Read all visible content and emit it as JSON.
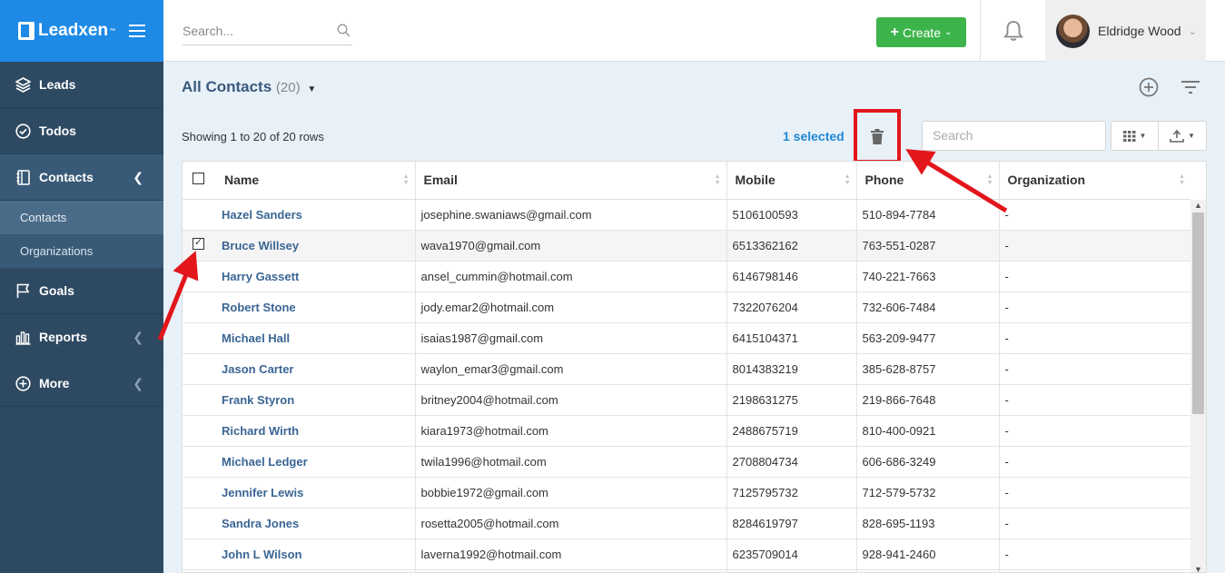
{
  "app": {
    "logo_text": "Leadxen",
    "logo_tm": "™"
  },
  "sidebar": {
    "items": [
      {
        "label": "Leads",
        "icon": "layers-icon"
      },
      {
        "label": "Todos",
        "icon": "check-circle-icon"
      },
      {
        "label": "Contacts",
        "icon": "contacts-book-icon"
      },
      {
        "label": "Goals",
        "icon": "flag-icon"
      },
      {
        "label": "Reports",
        "icon": "bar-chart-icon"
      },
      {
        "label": "More",
        "icon": "plus-circle-icon"
      }
    ],
    "contacts_sub": [
      "Contacts",
      "Organizations"
    ]
  },
  "topbar": {
    "search_placeholder": "Search...",
    "create_label": "Create",
    "user_name": "Eldridge Wood"
  },
  "list": {
    "title": "All Contacts",
    "count": "(20)",
    "showing": "Showing 1 to 20 of 20 rows",
    "selected": "1 selected",
    "search_placeholder": "Search"
  },
  "table": {
    "columns": [
      "Name",
      "Email",
      "Mobile",
      "Phone",
      "Organization"
    ],
    "rows": [
      {
        "name": "Hazel Sanders",
        "email": "josephine.swaniaws@gmail.com",
        "mobile": "5106100593",
        "phone": "510-894-7784",
        "org": "-",
        "checked": false
      },
      {
        "name": "Bruce Willsey",
        "email": "wava1970@gmail.com",
        "mobile": "6513362162",
        "phone": "763-551-0287",
        "org": "-",
        "checked": true
      },
      {
        "name": "Harry Gassett",
        "email": "ansel_cummin@hotmail.com",
        "mobile": "6146798146",
        "phone": "740-221-7663",
        "org": "-",
        "checked": false
      },
      {
        "name": "Robert Stone",
        "email": "jody.emar2@hotmail.com",
        "mobile": "7322076204",
        "phone": "732-606-7484",
        "org": "-",
        "checked": false
      },
      {
        "name": "Michael Hall",
        "email": "isaias1987@gmail.com",
        "mobile": "6415104371",
        "phone": "563-209-9477",
        "org": "-",
        "checked": false
      },
      {
        "name": "Jason Carter",
        "email": "waylon_emar3@gmail.com",
        "mobile": "8014383219",
        "phone": "385-628-8757",
        "org": "-",
        "checked": false
      },
      {
        "name": "Frank Styron",
        "email": "britney2004@hotmail.com",
        "mobile": "2198631275",
        "phone": "219-866-7648",
        "org": "-",
        "checked": false
      },
      {
        "name": "Richard Wirth",
        "email": "kiara1973@hotmail.com",
        "mobile": "2488675719",
        "phone": "810-400-0921",
        "org": "-",
        "checked": false
      },
      {
        "name": "Michael Ledger",
        "email": "twila1996@hotmail.com",
        "mobile": "2708804734",
        "phone": "606-686-3249",
        "org": "-",
        "checked": false
      },
      {
        "name": "Jennifer Lewis",
        "email": "bobbie1972@gmail.com",
        "mobile": "7125795732",
        "phone": "712-579-5732",
        "org": "-",
        "checked": false
      },
      {
        "name": "Sandra Jones",
        "email": "rosetta2005@hotmail.com",
        "mobile": "8284619797",
        "phone": "828-695-1193",
        "org": "-",
        "checked": false
      },
      {
        "name": "John L Wilson",
        "email": "laverna1992@hotmail.com",
        "mobile": "6235709014",
        "phone": "928-941-2460",
        "org": "-",
        "checked": false
      },
      {
        "name": "",
        "email": "",
        "mobile": "",
        "phone": "",
        "org": "",
        "checked": false
      }
    ]
  },
  "colors": {
    "brand_blue": "#1e8ae6",
    "sidebar": "#2e4a62",
    "create_green": "#3cb44b",
    "annotation_red": "#e2161b",
    "link_blue": "#3a6594"
  }
}
